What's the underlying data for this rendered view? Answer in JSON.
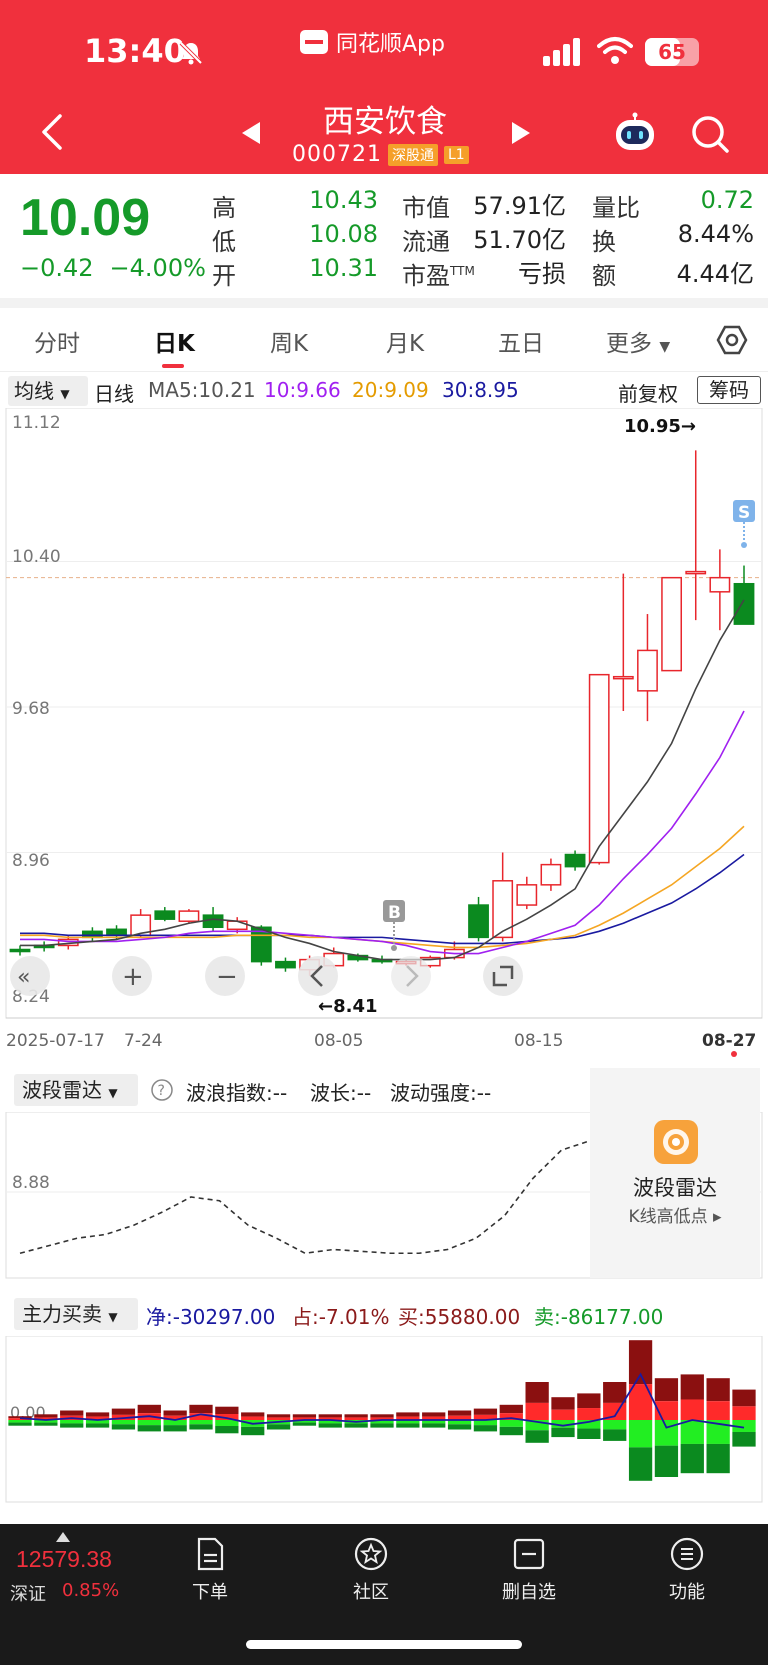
{
  "status_bar": {
    "time": "13:40",
    "battery": "65",
    "battery_level": 0.65,
    "app_name": "同花顺App"
  },
  "stock": {
    "name": "西安饮食",
    "code": "000721",
    "tags": [
      "深股通",
      "L1"
    ]
  },
  "quote": {
    "price": "10.09",
    "change": "−0.42",
    "change_pct": "−4.00%",
    "high_label": "高",
    "high": "10.43",
    "low_label": "低",
    "low": "10.08",
    "open_label": "开",
    "open": "10.31",
    "mcap_label": "市值",
    "mcap": "57.91亿",
    "float_label": "流通",
    "float": "51.70亿",
    "pe_label": "市盈",
    "pe_sup": "TTM",
    "pe": "亏损",
    "vr_label": "量比",
    "vr": "0.72",
    "turnover_label": "换",
    "turnover": "8.44%",
    "amount_label": "额",
    "amount": "4.44亿"
  },
  "tabs": [
    "分时",
    "日K",
    "周K",
    "月K",
    "五日",
    "更多"
  ],
  "indicator": {
    "selector": "均线",
    "period": "日线",
    "ma5": "MA5:10.21",
    "ma10": "10:9.66",
    "ma20": "20:9.09",
    "ma30": "30:8.95",
    "adjust": "前复权",
    "chip": "筹码"
  },
  "kchart": {
    "y_ticks": [
      "11.12",
      "10.40",
      "9.68",
      "8.96",
      "8.24"
    ],
    "x_ticks": [
      "2025-07-17",
      "7-24",
      "08-05",
      "08-15",
      "08-27"
    ],
    "high_mark": "10.95→",
    "low_mark": "←8.41",
    "buy_mark": "B",
    "sell_mark": "S",
    "colors": {
      "up": "#e8262c",
      "down": "#0b8a1f",
      "ma5": "#444444",
      "ma10": "#a020f0",
      "ma20": "#f5a623",
      "ma30": "#1a1aa0"
    }
  },
  "chart_data": [
    {
      "type": "candlestick",
      "ylim": [
        8.24,
        11.12
      ],
      "ohlc": [
        [
          8.48,
          8.5,
          8.45,
          8.47
        ],
        [
          8.5,
          8.52,
          8.47,
          8.49
        ],
        [
          8.5,
          8.55,
          8.48,
          8.53
        ],
        [
          8.57,
          8.59,
          8.52,
          8.54
        ],
        [
          8.58,
          8.6,
          8.53,
          8.55
        ],
        [
          8.55,
          8.68,
          8.54,
          8.65
        ],
        [
          8.67,
          8.69,
          8.62,
          8.63
        ],
        [
          8.62,
          8.68,
          8.61,
          8.67
        ],
        [
          8.65,
          8.69,
          8.57,
          8.59
        ],
        [
          8.58,
          8.64,
          8.56,
          8.62
        ],
        [
          8.59,
          8.6,
          8.4,
          8.42
        ],
        [
          8.42,
          8.44,
          8.37,
          8.39
        ],
        [
          8.38,
          8.45,
          8.35,
          8.43
        ],
        [
          8.4,
          8.49,
          8.39,
          8.46
        ],
        [
          8.45,
          8.46,
          8.42,
          8.43
        ],
        [
          8.43,
          8.45,
          8.41,
          8.42
        ],
        [
          8.41,
          8.43,
          8.4,
          8.42
        ],
        [
          8.4,
          8.45,
          8.39,
          8.44
        ],
        [
          8.44,
          8.52,
          8.43,
          8.48
        ],
        [
          8.7,
          8.74,
          8.52,
          8.54
        ],
        [
          8.54,
          8.96,
          8.52,
          8.82
        ],
        [
          8.7,
          8.84,
          8.68,
          8.8
        ],
        [
          8.8,
          8.93,
          8.77,
          8.9
        ],
        [
          8.95,
          8.97,
          8.87,
          8.89
        ],
        [
          8.91,
          9.84,
          8.9,
          9.84
        ],
        [
          9.83,
          10.34,
          9.66,
          9.83
        ],
        [
          9.76,
          10.14,
          9.61,
          9.96
        ],
        [
          9.86,
          10.3,
          9.86,
          10.32
        ],
        [
          10.34,
          10.95,
          10.11,
          10.35
        ],
        [
          10.25,
          10.46,
          10.06,
          10.32
        ],
        [
          10.29,
          10.38,
          10.09,
          10.09
        ]
      ],
      "ma5": [
        8.5,
        8.5,
        8.51,
        8.52,
        8.53,
        8.56,
        8.58,
        8.61,
        8.63,
        8.62,
        8.58,
        8.54,
        8.51,
        8.47,
        8.45,
        8.43,
        8.43,
        8.43,
        8.44,
        8.49,
        8.57,
        8.63,
        8.7,
        8.78,
        8.99,
        9.15,
        9.31,
        9.5,
        9.77,
        10.01,
        10.21
      ],
      "ma10": [
        8.53,
        8.53,
        8.52,
        8.52,
        8.52,
        8.53,
        8.54,
        8.56,
        8.57,
        8.57,
        8.57,
        8.56,
        8.55,
        8.54,
        8.53,
        8.52,
        8.5,
        8.47,
        8.46,
        8.46,
        8.49,
        8.52,
        8.56,
        8.6,
        8.7,
        8.83,
        8.95,
        9.08,
        9.25,
        9.43,
        9.66
      ],
      "ma20": [
        8.55,
        8.55,
        8.54,
        8.54,
        8.54,
        8.54,
        8.54,
        8.54,
        8.54,
        8.55,
        8.55,
        8.55,
        8.54,
        8.54,
        8.53,
        8.52,
        8.51,
        8.5,
        8.49,
        8.49,
        8.5,
        8.51,
        8.53,
        8.55,
        8.6,
        8.66,
        8.73,
        8.8,
        8.89,
        8.98,
        9.09
      ],
      "ma30": [
        8.56,
        8.56,
        8.55,
        8.55,
        8.55,
        8.55,
        8.55,
        8.55,
        8.55,
        8.55,
        8.55,
        8.55,
        8.55,
        8.54,
        8.54,
        8.54,
        8.53,
        8.52,
        8.51,
        8.51,
        8.51,
        8.52,
        8.53,
        8.54,
        8.57,
        8.61,
        8.66,
        8.71,
        8.78,
        8.86,
        8.95
      ]
    },
    {
      "type": "line",
      "name": "波段雷达",
      "y_tick": "8.88",
      "values": [
        8.3,
        8.34,
        8.38,
        8.4,
        8.45,
        8.52,
        8.6,
        8.58,
        8.45,
        8.38,
        8.3,
        8.32,
        8.31,
        8.3,
        8.3,
        8.32,
        8.38,
        8.5,
        8.7,
        8.85,
        8.9
      ]
    },
    {
      "type": "bar",
      "name": "主力买卖",
      "y_tick": "0.00",
      "buy": [
        2,
        3,
        5,
        4,
        6,
        8,
        5,
        8,
        7,
        4,
        3,
        3,
        3,
        3,
        3,
        4,
        4,
        5,
        6,
        8,
        20,
        12,
        14,
        20,
        42,
        22,
        24,
        22,
        16
      ],
      "sell": [
        -3,
        -3,
        -4,
        -4,
        -5,
        -6,
        -6,
        -5,
        -7,
        -8,
        -5,
        -3,
        -4,
        -4,
        -4,
        -4,
        -4,
        -5,
        -6,
        -8,
        -12,
        -9,
        -10,
        -11,
        -32,
        -30,
        -28,
        -28,
        -14
      ],
      "line": [
        1,
        0,
        1,
        0,
        1,
        2,
        0,
        3,
        1,
        -2,
        -1,
        0,
        0,
        -1,
        0,
        0,
        0,
        0,
        0,
        1,
        -1,
        -3,
        -1,
        2,
        24,
        -4,
        0,
        -2,
        -4
      ]
    }
  ],
  "wave": {
    "selector": "波段雷达",
    "wave_index": "波浪指数:--",
    "wave_len": "波长:--",
    "wave_strength": "波动强度:--",
    "card_title": "波段雷达",
    "card_sub": "K线高低点 ▸"
  },
  "main_force": {
    "selector": "主力买卖",
    "net": "净:-30297.00",
    "ratio": "占:-7.01%",
    "buy": "买:55880.00",
    "sell": "卖:-86177.00",
    "colors": {
      "net": "#1a1aa0",
      "ratio": "#8b1a1a",
      "buy": "#8b1a1a",
      "sell": "#159a29"
    }
  },
  "bottom": {
    "index_value": "12579.38",
    "index_name": "深证",
    "index_pct": "0.85%",
    "nav": [
      "下单",
      "社区",
      "删自选",
      "功能"
    ]
  }
}
